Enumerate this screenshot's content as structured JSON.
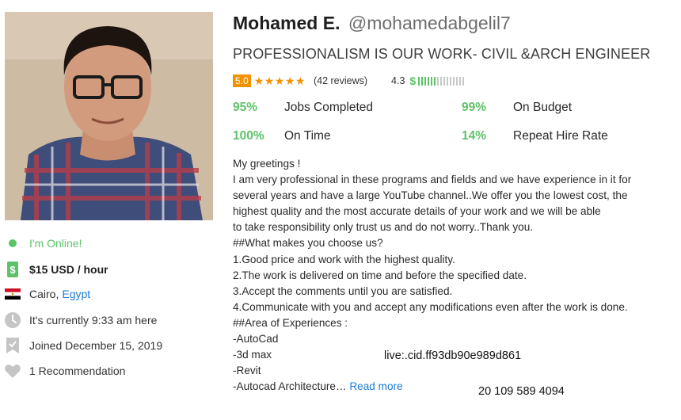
{
  "profile": {
    "name": "Mohamed E.",
    "handle": "@mohamedabgelil7",
    "tagline": "PROFESSIONALISM IS OUR WORK- CIVIL &ARCH ENGINEER",
    "photo_icon": "profile-photo"
  },
  "rating": {
    "score": "5.0",
    "stars": "★★★★★",
    "star_count": 5,
    "reviews": "(42 reviews)",
    "earnings_score": "4.3",
    "earnings_symbol": "$",
    "earnings_level": 0.43,
    "colors": {
      "accent_orange": "#f39200",
      "accent_green": "#5dc26a",
      "link_blue": "#1a7bd3"
    }
  },
  "stats": [
    {
      "pct": "95%",
      "label": "Jobs Completed"
    },
    {
      "pct": "99%",
      "label": "On Budget"
    },
    {
      "pct": "100%",
      "label": "On Time"
    },
    {
      "pct": "14%",
      "label": "Repeat Hire Rate"
    }
  ],
  "sidebar": {
    "online": "I'm Online!",
    "rate": "$15 USD / hour",
    "city": "Cairo,",
    "country": "Egypt",
    "local_time": "It's currently 9:33 am here",
    "joined": "Joined December 15, 2019",
    "recommendations": "1 Recommendation",
    "icons": [
      "online-dot-icon",
      "dollar-tag-icon",
      "egypt-flag-icon",
      "clock-icon",
      "badge-icon",
      "heart-icon"
    ]
  },
  "bio": {
    "lines": [
      "My greetings !",
      "I am very professional in these programs and fields and we have experience in it for",
      "several years and have a large YouTube channel..We offer you the lowest cost, the",
      "highest quality and the most accurate details of your work and we will be able",
      "to take responsibility only trust us and do not worry..Thank you.",
      "##What makes you choose us?",
      "1.Good price and work with the highest quality.",
      "2.The work is delivered on time and before the specified date.",
      "3.Accept the comments until you are satisfied.",
      "4.Communicate with you and accept any modifications even after the work is done.",
      "##Area of Experiences :",
      "-AutoCad",
      "-3d max",
      "-Revit",
      "-Autocad Architecture…"
    ],
    "read_more": "Read more"
  },
  "overlays": {
    "cid": "live:.cid.ff93db90e989d861",
    "phone": "20 109 589 4094"
  }
}
